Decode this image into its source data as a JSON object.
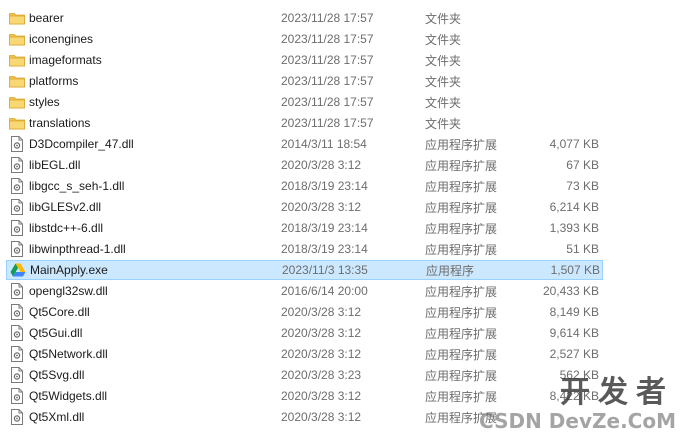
{
  "files": [
    {
      "name": "bearer",
      "date": "2023/11/28 17:57",
      "type": "文件夹",
      "size": "",
      "icon": "folder-icon"
    },
    {
      "name": "iconengines",
      "date": "2023/11/28 17:57",
      "type": "文件夹",
      "size": "",
      "icon": "folder-icon"
    },
    {
      "name": "imageformats",
      "date": "2023/11/28 17:57",
      "type": "文件夹",
      "size": "",
      "icon": "folder-icon"
    },
    {
      "name": "platforms",
      "date": "2023/11/28 17:57",
      "type": "文件夹",
      "size": "",
      "icon": "folder-icon"
    },
    {
      "name": "styles",
      "date": "2023/11/28 17:57",
      "type": "文件夹",
      "size": "",
      "icon": "folder-icon"
    },
    {
      "name": "translations",
      "date": "2023/11/28 17:57",
      "type": "文件夹",
      "size": "",
      "icon": "folder-icon"
    },
    {
      "name": "D3Dcompiler_47.dll",
      "date": "2014/3/11 18:54",
      "type": "应用程序扩展",
      "size": "4,077 KB",
      "icon": "dll-file-icon"
    },
    {
      "name": "libEGL.dll",
      "date": "2020/3/28 3:12",
      "type": "应用程序扩展",
      "size": "67 KB",
      "icon": "dll-file-icon"
    },
    {
      "name": "libgcc_s_seh-1.dll",
      "date": "2018/3/19 23:14",
      "type": "应用程序扩展",
      "size": "73 KB",
      "icon": "dll-file-icon"
    },
    {
      "name": "libGLESv2.dll",
      "date": "2020/3/28 3:12",
      "type": "应用程序扩展",
      "size": "6,214 KB",
      "icon": "dll-file-icon"
    },
    {
      "name": "libstdc++-6.dll",
      "date": "2018/3/19 23:14",
      "type": "应用程序扩展",
      "size": "1,393 KB",
      "icon": "dll-file-icon"
    },
    {
      "name": "libwinpthread-1.dll",
      "date": "2018/3/19 23:14",
      "type": "应用程序扩展",
      "size": "51 KB",
      "icon": "dll-file-icon"
    },
    {
      "name": "MainApply.exe",
      "date": "2023/11/3 13:35",
      "type": "应用程序",
      "size": "1,507 KB",
      "icon": "app-icon",
      "selected": true
    },
    {
      "name": "opengl32sw.dll",
      "date": "2016/6/14 20:00",
      "type": "应用程序扩展",
      "size": "20,433 KB",
      "icon": "dll-file-icon"
    },
    {
      "name": "Qt5Core.dll",
      "date": "2020/3/28 3:12",
      "type": "应用程序扩展",
      "size": "8,149 KB",
      "icon": "dll-file-icon"
    },
    {
      "name": "Qt5Gui.dll",
      "date": "2020/3/28 3:12",
      "type": "应用程序扩展",
      "size": "9,614 KB",
      "icon": "dll-file-icon"
    },
    {
      "name": "Qt5Network.dll",
      "date": "2020/3/28 3:12",
      "type": "应用程序扩展",
      "size": "2,527 KB",
      "icon": "dll-file-icon"
    },
    {
      "name": "Qt5Svg.dll",
      "date": "2020/3/28 3:23",
      "type": "应用程序扩展",
      "size": "562 KB",
      "icon": "dll-file-icon"
    },
    {
      "name": "Qt5Widgets.dll",
      "date": "2020/3/28 3:12",
      "type": "应用程序扩展",
      "size": "8,422 KB",
      "icon": "dll-file-icon"
    },
    {
      "name": "Qt5Xml.dll",
      "date": "2020/3/28 3:12",
      "type": "应用程序扩展",
      "size": "",
      "icon": "dll-file-icon"
    }
  ],
  "watermark": {
    "line1": "开发者",
    "line2": "CSDN DevZe.CoM"
  },
  "colors": {
    "selected_bg": "#cce8ff",
    "selected_border": "#99d1ff",
    "folder": "#f8d775",
    "meta_text": "#6d6d6d"
  }
}
